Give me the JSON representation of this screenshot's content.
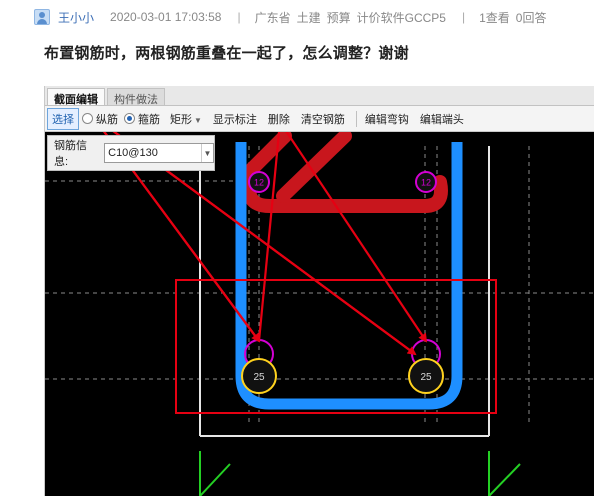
{
  "post": {
    "author": "王小小",
    "date": "2020-03-01 17:03:58",
    "separator": "|",
    "location": "广东省",
    "tags": [
      "土建",
      "预算",
      "计价软件GCCP5"
    ],
    "views": "1查看",
    "answers": "0回答",
    "question": "布置钢筋时，两根钢筋重叠在一起了，怎么调整？谢谢"
  },
  "app": {
    "tabs": [
      {
        "label": "截面编辑",
        "active": true
      },
      {
        "label": "构件做法",
        "active": false
      }
    ],
    "toolbar": {
      "select": "选择",
      "longitudinal": "纵筋",
      "stirrup": "箍筋",
      "shape": "矩形",
      "show_annotation": "显示标注",
      "delete": "删除",
      "clear_rebar": "清空钢筋",
      "edit_hook": "编辑弯钩",
      "edit_end": "编辑端头"
    },
    "rebar_info": {
      "label": "钢筋信息:",
      "value": "C10@130"
    },
    "drawing": {
      "rebar_labels": [
        "12",
        "12",
        "25",
        "25"
      ],
      "colors": {
        "background": "#000000",
        "stirrup": "#1e8fff",
        "tie": "#c8161d",
        "small_bar": "#d400d4",
        "large_bar": "#ffd21e",
        "annotation": "#e60012",
        "outline": "#e6e6e6",
        "leader": "#24d024"
      }
    }
  }
}
